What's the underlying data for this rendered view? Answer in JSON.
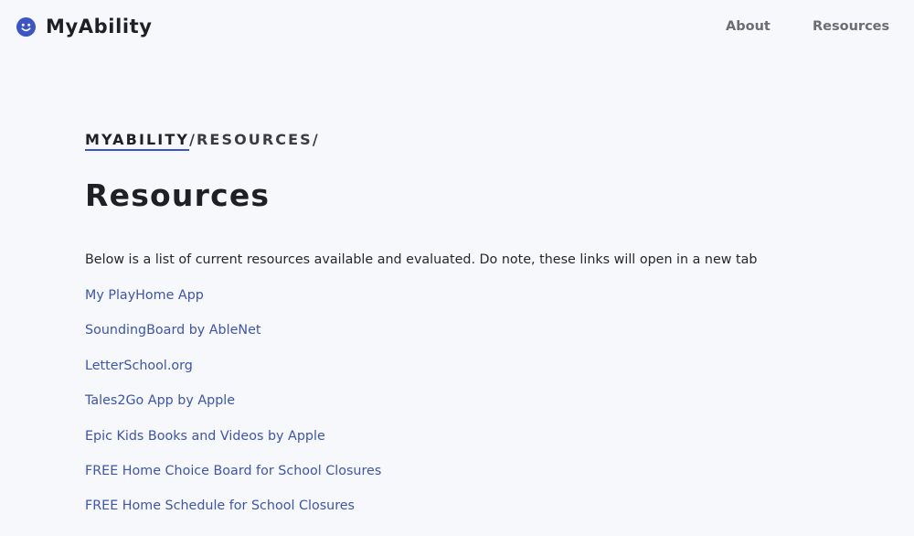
{
  "navbar": {
    "brand_icon": "smiley-face-icon",
    "brand_name": "MyAbility",
    "links": [
      {
        "label": "About"
      },
      {
        "label": "Resources"
      }
    ]
  },
  "breadcrumb": {
    "home": "MYABILITY",
    "separator1": "/",
    "current": "RESOURCES",
    "separator2": "/"
  },
  "page": {
    "title": "Resources",
    "intro": "Below is a list of current resources available and evaluated. Do note, these links will open in a new tab"
  },
  "resources": [
    {
      "label": "My PlayHome App"
    },
    {
      "label": "SoundingBoard by AbleNet"
    },
    {
      "label": "LetterSchool.org"
    },
    {
      "label": "Tales2Go App by Apple"
    },
    {
      "label": "Epic Kids Books and Videos by Apple"
    },
    {
      "label": "FREE Home Choice Board for School Closures"
    },
    {
      "label": "FREE Home Schedule for School Closures"
    }
  ],
  "colors": {
    "accent": "#3b55c5",
    "link": "#3b55b0",
    "background": "#f7f8fb",
    "text": "#1f2025",
    "nav_text": "#6b6d73"
  }
}
